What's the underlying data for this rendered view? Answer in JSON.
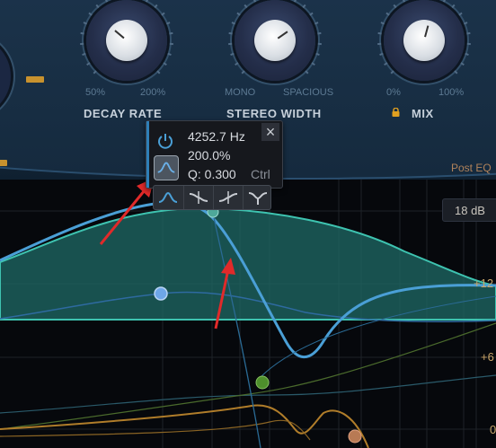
{
  "knobs": {
    "decay": {
      "title": "DECAY RATE",
      "min_label": "50%",
      "max_label": "200%",
      "value_fraction": 0.22
    },
    "stereo": {
      "title": "STEREO WIDTH",
      "min_label": "MONO",
      "max_label": "SPACIOUS",
      "value_fraction": 0.78
    },
    "mix": {
      "title": "MIX",
      "min_label": "0%",
      "max_label": "100%",
      "value_fraction": 0.55,
      "locked": true
    }
  },
  "graph": {
    "post_eq_label": "Post EQ",
    "range_value": "18 dB",
    "db_labels": {
      "plus12": "+12",
      "plus6": "+6",
      "zero": "0"
    }
  },
  "band_popup": {
    "frequency": "4252.7 Hz",
    "gain": "200.0%",
    "q": "Q: 0.300",
    "modifier_hint": "Ctrl",
    "close_glyph": "×",
    "shapes": [
      "bell-icon",
      "low-shelf-icon",
      "high-shelf-icon",
      "notch-icon"
    ],
    "selected_shape": "bell-icon"
  },
  "colors": {
    "accent_blue": "#4a9fd6",
    "teal_fill": "#1f6a66",
    "arrow_red": "#e02a2a",
    "gold": "#c8922e",
    "node_green": "#4e8f2c"
  }
}
